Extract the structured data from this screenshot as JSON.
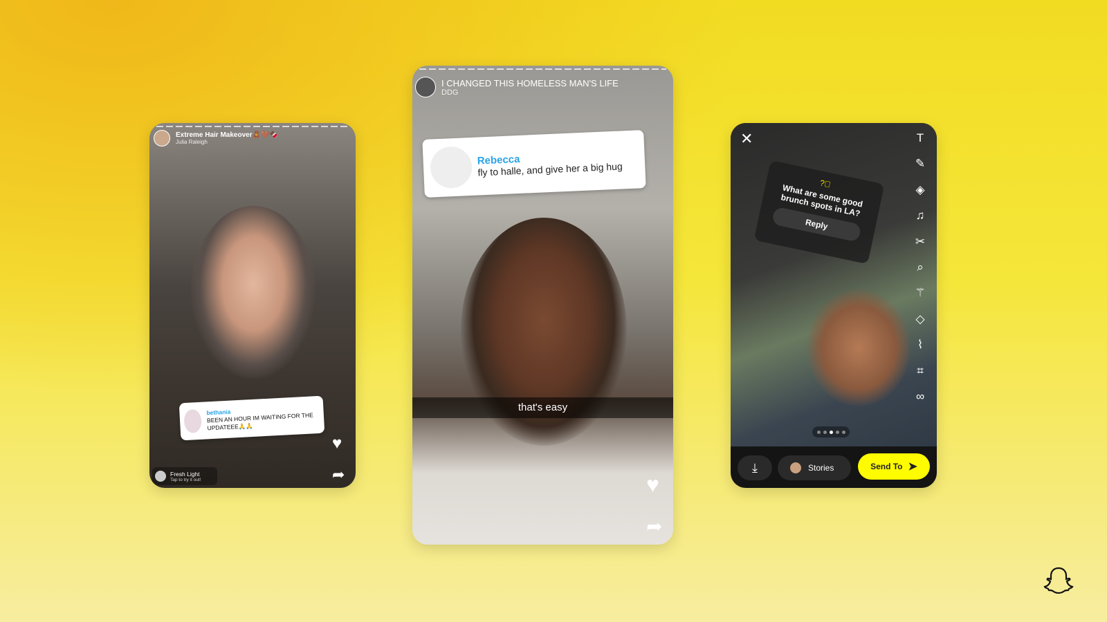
{
  "left_story": {
    "title": "Extreme Hair Makeover🧸🤎🍫",
    "author": "Julia Raleigh",
    "comment": {
      "name": "bethania",
      "text": "BEEN AN HOUR IM WAITING FOR THE UPDATEEE🙏🙏"
    },
    "lens": {
      "name": "Fresh Light",
      "hint": "Tap to try it out!"
    }
  },
  "center_story": {
    "title": "I CHANGED THIS HOMELESS MAN'S LIFE",
    "author": "DDG",
    "comment": {
      "name": "Rebecca",
      "text": "fly to halle, and give her a big hug"
    },
    "caption": "that's easy"
  },
  "right_snap": {
    "question": "What are some good brunch spots in LA?",
    "reply_label": "Reply",
    "stories_label": "Stories",
    "send_label": "Send To",
    "page_dots": 5,
    "active_dot": 3,
    "tools": [
      "text-icon",
      "pencil-icon",
      "sticker-icon",
      "music-icon",
      "scissors-icon",
      "lens-search-icon",
      "magic-wand-icon",
      "eraser-icon",
      "paperclip-icon",
      "crop-icon",
      "timer-icon"
    ]
  },
  "colors": {
    "accent": "#FFFC00",
    "comment_name": "#2BA3E6"
  }
}
